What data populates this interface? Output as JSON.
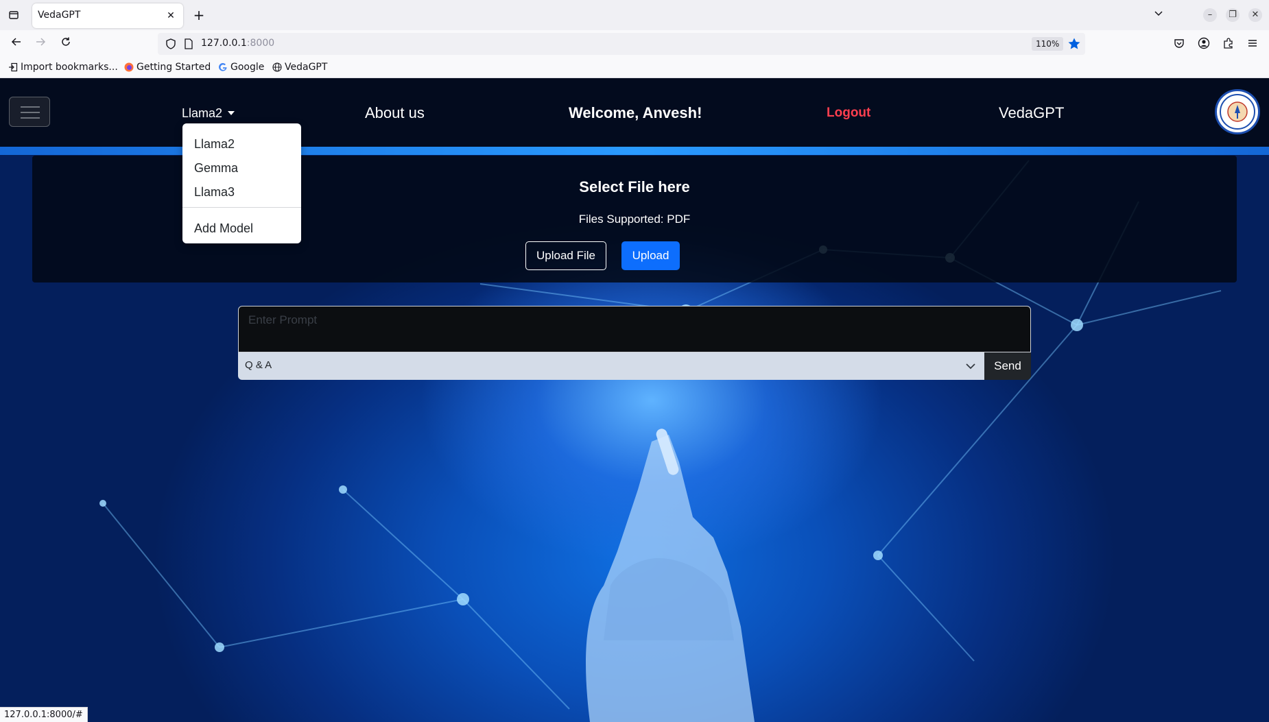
{
  "browser": {
    "tab_title": "VedaGPT",
    "url_host": "127.0.0.1",
    "url_port": ":8000",
    "zoom": "110%",
    "status_url": "127.0.0.1:8000/#",
    "bookmarks": [
      {
        "label": "Import bookmarks...",
        "icon": "import-icon"
      },
      {
        "label": "Getting Started",
        "icon": "firefox-icon"
      },
      {
        "label": "Google",
        "icon": "google-icon"
      },
      {
        "label": "VedaGPT",
        "icon": "globe-icon"
      }
    ]
  },
  "header": {
    "model_label": "Llama2",
    "about_label": "About us",
    "welcome_text": "Welcome, Anvesh!",
    "logout_label": "Logout",
    "brand_label": "VedaGPT",
    "logout_color": "#ff3f4f"
  },
  "model_menu": {
    "items": [
      "Llama2",
      "Gemma",
      "Llama3"
    ],
    "add_label": "Add Model"
  },
  "upload": {
    "title": "Select File here",
    "subtitle": "Files Supported: PDF",
    "choose_label": "Upload File",
    "upload_label": "Upload",
    "primary_color": "#0d6efd"
  },
  "chat": {
    "prompt_placeholder": "Enter Prompt",
    "mode_value": "Q & A",
    "send_label": "Send"
  }
}
